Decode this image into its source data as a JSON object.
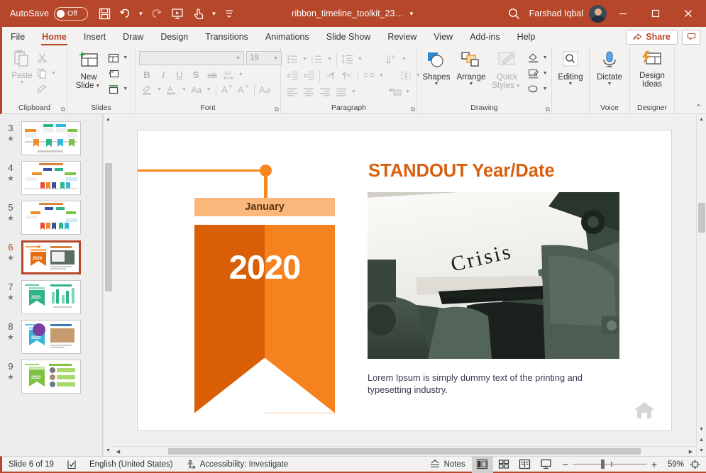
{
  "titlebar": {
    "autosave_label": "AutoSave",
    "autosave_state": "Off",
    "save_icon": "save-icon",
    "undo_icon": "undo-icon",
    "redo_icon": "redo-icon",
    "present_icon": "start-presentation-icon",
    "touch_icon": "touch-mode-icon",
    "customize_icon": "customize-quick-access-icon",
    "doc_title": "ribbon_timeline_toolkit_23…",
    "search_icon": "search-icon",
    "user_name": "Farshad Iqbal",
    "avatar": "user-avatar",
    "minimize": "minimize-icon",
    "maximize": "maximize-icon",
    "close": "close-icon",
    "brand_color": "#b7472a"
  },
  "tabs": [
    {
      "label": "File",
      "active": false
    },
    {
      "label": "Home",
      "active": true
    },
    {
      "label": "Insert",
      "active": false
    },
    {
      "label": "Draw",
      "active": false
    },
    {
      "label": "Design",
      "active": false
    },
    {
      "label": "Transitions",
      "active": false
    },
    {
      "label": "Animations",
      "active": false
    },
    {
      "label": "Slide Show",
      "active": false
    },
    {
      "label": "Review",
      "active": false
    },
    {
      "label": "View",
      "active": false
    },
    {
      "label": "Add-ins",
      "active": false
    },
    {
      "label": "Help",
      "active": false
    }
  ],
  "tabs_right": {
    "share_label": "Share",
    "share_icon": "share-icon",
    "comments_icon": "comments-icon"
  },
  "ribbon": {
    "groups": [
      {
        "name": "Clipboard",
        "label": "Clipboard",
        "launcher": true
      },
      {
        "name": "Slides",
        "label": "Slides",
        "launcher": false
      },
      {
        "name": "Font",
        "label": "Font",
        "launcher": true
      },
      {
        "name": "Paragraph",
        "label": "Paragraph",
        "launcher": true
      },
      {
        "name": "Drawing",
        "label": "Drawing",
        "launcher": true
      },
      {
        "name": "Editing",
        "label": "",
        "launcher": false
      },
      {
        "name": "Voice",
        "label": "Voice",
        "launcher": false
      },
      {
        "name": "Designer",
        "label": "Designer",
        "launcher": false
      }
    ],
    "clipboard": {
      "paste_label": "Paste",
      "paste_icon": "paste-icon",
      "cut_icon": "cut-icon",
      "copy_icon": "copy-icon",
      "format_painter_icon": "format-painter-icon"
    },
    "slides": {
      "new_slide_label_1": "New",
      "new_slide_label_2": "Slide",
      "new_slide_icon": "new-slide-icon",
      "layout_icon": "slide-layout-icon",
      "reset_icon": "reset-slide-icon",
      "section_icon": "section-icon"
    },
    "font": {
      "font_name": "",
      "font_size": "19",
      "bold": "B",
      "italic": "I",
      "underline": "U",
      "shadow": "S",
      "strikethrough": "ab",
      "char_spacing_icon": "character-spacing-icon",
      "text_highlight_icon": "text-highlight-icon",
      "font_color_icon": "font-color-icon",
      "change_case_label": "Aa",
      "increase_size": "A",
      "decrease_size": "A",
      "clear_format_icon": "clear-formatting-icon"
    },
    "paragraph": {
      "bullets_icon": "bullets-icon",
      "numbering_icon": "numbering-icon",
      "line_spacing_icon": "line-spacing-icon",
      "text_direction_icon": "text-direction-icon",
      "decrease_indent_icon": "decrease-indent-icon",
      "increase_indent_icon": "increase-indent-icon",
      "ltr_icon": "left-to-right-icon",
      "rtl_icon": "right-to-left-icon",
      "columns_icon": "columns-icon",
      "align_text_icon": "align-text-icon",
      "align_left_icon": "align-left-icon",
      "align_center_icon": "align-center-icon",
      "align_right_icon": "align-right-icon",
      "justify_icon": "justify-icon",
      "smartart_icon": "convert-to-smartart-icon"
    },
    "drawing": {
      "shapes_label": "Shapes",
      "shapes_icon": "shapes-icon",
      "arrange_label": "Arrange",
      "arrange_icon": "arrange-icon",
      "quick_styles_label_1": "Quick",
      "quick_styles_label_2": "Styles",
      "quick_styles_icon": "quick-styles-icon",
      "shape_fill_icon": "shape-fill-icon",
      "shape_outline_icon": "shape-outline-icon",
      "shape_effects_icon": "shape-effects-icon"
    },
    "editing": {
      "label": "Editing",
      "icon": "find-icon"
    },
    "voice": {
      "dictate_label": "Dictate",
      "dictate_icon": "microphone-icon"
    },
    "designer": {
      "design_ideas_label_1": "Design",
      "design_ideas_label_2": "Ideas",
      "design_ideas_icon": "design-ideas-icon"
    },
    "collapse_icon": "collapse-ribbon-icon"
  },
  "thumbnails": {
    "items": [
      {
        "number": "3",
        "star": "★",
        "selected": false,
        "style": "timeline-4-ribbons"
      },
      {
        "number": "4",
        "star": "★",
        "selected": false,
        "style": "timeline-6-ribbons"
      },
      {
        "number": "5",
        "star": "★",
        "selected": false,
        "style": "timeline-6-ribbons-b"
      },
      {
        "number": "6",
        "star": "★",
        "selected": true,
        "style": "standout-year-orange"
      },
      {
        "number": "7",
        "star": "★",
        "selected": false,
        "style": "green-ribbon-chart"
      },
      {
        "number": "8",
        "star": "★",
        "selected": false,
        "style": "blue-ribbon-photo"
      },
      {
        "number": "9",
        "star": "★",
        "selected": false,
        "style": "green-ribbon-list"
      }
    ]
  },
  "slide": {
    "month": "January",
    "year": "2020",
    "title": "STANDOUT Year/Date",
    "body": "Lorem Ipsum is simply dummy text of the printing and typesetting industry.",
    "photo_alt": "typewriter-with-crisis-text",
    "photo_word": "Crisis",
    "home_icon": "home-icon",
    "colors": {
      "accent_dark": "#d85f06",
      "accent": "#f6821f",
      "accent_light": "#fbb87c",
      "title_color": "#d95f0e",
      "month_text": "#5d3212"
    }
  },
  "statusbar": {
    "slide_count": "Slide 6 of 19",
    "spellcheck_icon": "spellcheck-icon",
    "language": "English (United States)",
    "accessibility_icon": "accessibility-icon",
    "accessibility": "Accessibility: Investigate",
    "notes_label": "Notes",
    "notes_icon": "notes-icon",
    "view_normal_icon": "normal-view-icon",
    "view_sorter_icon": "slide-sorter-icon",
    "view_reading_icon": "reading-view-icon",
    "view_slideshow_icon": "slideshow-view-icon",
    "zoom_out": "−",
    "zoom_in": "+",
    "zoom_level": "59%",
    "fit_icon": "fit-slide-to-window-icon"
  }
}
